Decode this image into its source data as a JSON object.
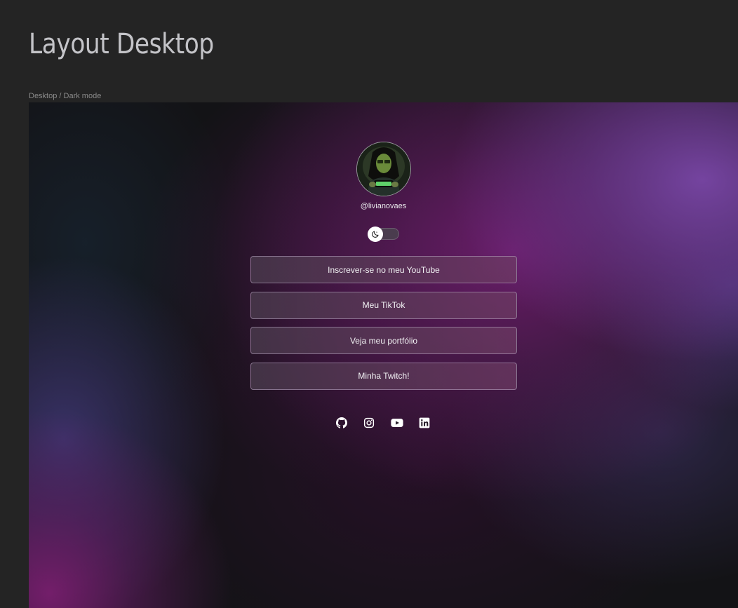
{
  "page": {
    "title": "Layout Desktop",
    "frame_label": "Desktop / Dark mode"
  },
  "profile": {
    "avatar": "avatar-photo",
    "username": "@livianovaes"
  },
  "theme_toggle": {
    "icon": "moon-icon",
    "state": "dark"
  },
  "links": [
    {
      "label": "Inscrever-se no meu YouTube"
    },
    {
      "label": "Meu TikTok"
    },
    {
      "label": "Veja meu portfólio"
    },
    {
      "label": "Minha Twitch!"
    }
  ],
  "socials": [
    {
      "icon": "github-icon"
    },
    {
      "icon": "instagram-icon"
    },
    {
      "icon": "youtube-icon"
    },
    {
      "icon": "linkedin-icon"
    }
  ],
  "colors": {
    "canvas_bg": "#242424",
    "frame_bg": "#131316",
    "accent_purple": "#6e1e6e",
    "accent_violet": "#784aa5",
    "button_border": "#beaac8",
    "text": "#f3f3f5"
  }
}
